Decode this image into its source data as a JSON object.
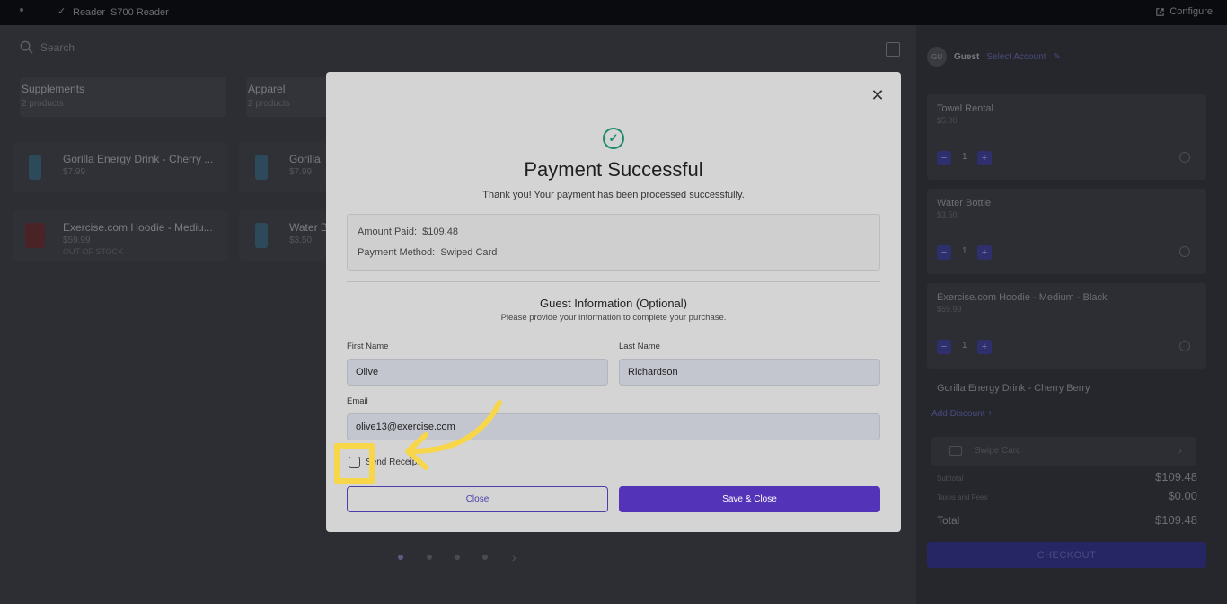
{
  "topbar": {
    "reader_label": "Reader",
    "reader_model": "S700 Reader",
    "configure_label": "Configure"
  },
  "search": {
    "placeholder": "Search"
  },
  "categories": [
    {
      "name": "Supplements",
      "count": "2 products"
    },
    {
      "name": "Apparel",
      "count": "2 products"
    }
  ],
  "products": [
    {
      "name": "Gorilla Energy Drink - Cherry ...",
      "price": "$7.99",
      "stock": ""
    },
    {
      "name": "Gorilla",
      "price": "$7.99",
      "stock": ""
    },
    {
      "name": "Exercise.com Hoodie - Mediu...",
      "price": "$59.99",
      "stock": "OUT OF STOCK"
    },
    {
      "name": "Water B",
      "price": "$3.50",
      "stock": ""
    }
  ],
  "cart": {
    "guest_initials": "GU",
    "guest_label": "Guest",
    "select_account": "Select Account",
    "items": [
      {
        "name": "Towel Rental",
        "price": "$5.00",
        "qty": "1"
      },
      {
        "name": "Water Bottle",
        "price": "$3.50",
        "qty": "1"
      },
      {
        "name": "Exercise.com Hoodie - Medium - Black",
        "price": "$59.99",
        "qty": "1"
      }
    ],
    "partial_item": "Gorilla Energy Drink - Cherry Berry",
    "add_discount": "Add Discount",
    "payment_method": "Swipe Card",
    "subtotal_label": "Subtotal",
    "subtotal_value": "$109.48",
    "taxes_label": "Taxes and Fees",
    "taxes_value": "$0.00",
    "total_label": "Total",
    "total_value": "$109.48",
    "checkout_label": "CHECKOUT"
  },
  "modal": {
    "title": "Payment Successful",
    "subtitle": "Thank you! Your payment has been processed successfully.",
    "amount_paid_label": "Amount Paid:",
    "amount_paid_value": "$109.48",
    "payment_method_label": "Payment Method:",
    "payment_method_value": "Swiped Card",
    "guest_title": "Guest Information (Optional)",
    "guest_subtitle": "Please provide your information to complete your purchase.",
    "first_name_label": "First Name",
    "first_name_value": "Olive",
    "last_name_label": "Last Name",
    "last_name_value": "Richardson",
    "email_label": "Email",
    "email_value": "olive13@exercise.com",
    "send_receipt_label": "Send Receipt",
    "close_label": "Close",
    "save_close_label": "Save & Close"
  },
  "colors": {
    "accent": "#5334b8",
    "success": "#1b8a6b",
    "highlight": "#f8d64a"
  }
}
